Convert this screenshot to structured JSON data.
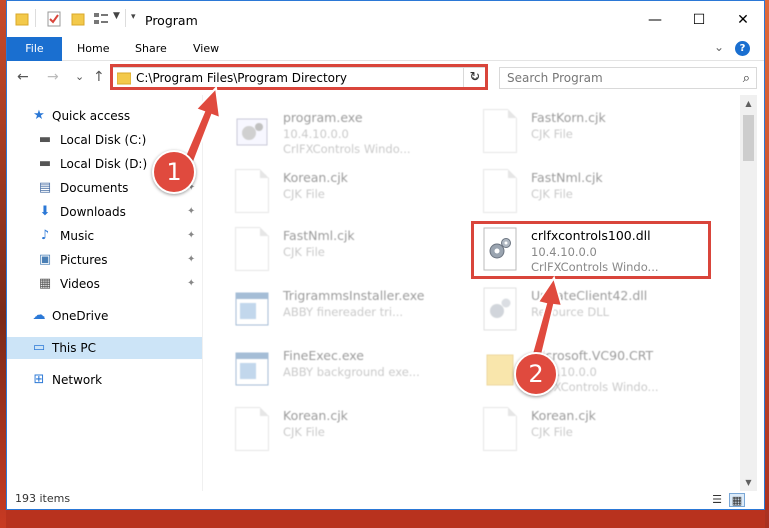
{
  "window": {
    "title": "Program",
    "minimize_glyph": "—",
    "maximize_glyph": "☐",
    "close_glyph": "✕"
  },
  "ribbon": {
    "tabs": [
      "File",
      "Home",
      "Share",
      "View"
    ],
    "help_glyph": "?",
    "collapse_glyph": "⌄"
  },
  "nav": {
    "back": "←",
    "forward": "→",
    "recent": "⌄",
    "up": "↑",
    "address": "C:\\Program Files\\Program Directory",
    "address_dropdown": "⌄",
    "refresh": "↻",
    "search_placeholder": "Search Program",
    "search_glyph": "⌕"
  },
  "sidebar": {
    "items": [
      {
        "label": "Quick access",
        "icon": "star-icon",
        "glyph": "★",
        "color": "#2b78d6"
      },
      {
        "label": "Local Disk (C:)",
        "icon": "drive-icon",
        "glyph": "▬",
        "color": "#555555"
      },
      {
        "label": "Local Disk (D:)",
        "icon": "drive-icon",
        "glyph": "▬",
        "color": "#555555"
      },
      {
        "label": "Documents",
        "icon": "documents-icon",
        "glyph": "▤",
        "color": "#4a6fa5"
      },
      {
        "label": "Downloads",
        "icon": "download-icon",
        "glyph": "⬇",
        "color": "#2b78d6"
      },
      {
        "label": "Music",
        "icon": "music-icon",
        "glyph": "♪",
        "color": "#2b78d6"
      },
      {
        "label": "Pictures",
        "icon": "pictures-icon",
        "glyph": "▣",
        "color": "#4a7fb5"
      },
      {
        "label": "Videos",
        "icon": "videos-icon",
        "glyph": "▦",
        "color": "#555555"
      },
      {
        "label": "OneDrive",
        "icon": "cloud-icon",
        "glyph": "☁",
        "color": "#2b78d6"
      },
      {
        "label": "This PC",
        "icon": "computer-icon",
        "glyph": "▭",
        "color": "#2b78d6"
      },
      {
        "label": "Network",
        "icon": "network-icon",
        "glyph": "⊞",
        "color": "#2b78d6"
      }
    ],
    "pin_glyph": "📌"
  },
  "files": [
    {
      "name": "program.exe",
      "line1": "10.4.10.0.0",
      "line2": "CrlFXControls Windo...",
      "icon": "exe-gear-icon"
    },
    {
      "name": "FastKorn.cjk",
      "line1": "CJK File",
      "line2": "",
      "icon": "document-icon"
    },
    {
      "name": "Korean.cjk",
      "line1": "CJK File",
      "line2": "",
      "icon": "document-icon"
    },
    {
      "name": "FastNml.cjk",
      "line1": "CJK File",
      "line2": "",
      "icon": "document-icon"
    },
    {
      "name": "FastNml.cjk",
      "line1": "CJK File",
      "line2": "",
      "icon": "document-icon"
    },
    {
      "name": "crlfxcontrols100.dll",
      "line1": "10.4.10.0.0",
      "line2": "CrlFXControls Windo...",
      "icon": "dll-gear-icon"
    },
    {
      "name": "TrigrammsInstaller.exe",
      "line1": "ABBY finereader tri...",
      "line2": "",
      "icon": "window-app-icon"
    },
    {
      "name": "UpdateClient42.dll",
      "line1": "Resource DLL",
      "line2": "",
      "icon": "dll-gear-icon"
    },
    {
      "name": "FineExec.exe",
      "line1": "ABBY background exe...",
      "line2": "",
      "icon": "window-app-icon"
    },
    {
      "name": "Microsoft.VC90.CRT",
      "line1": "10.4.10.0.0",
      "line2": "CrlFXControls Windo...",
      "icon": "folder-icon"
    },
    {
      "name": "Korean.cjk",
      "line1": "CJK File",
      "line2": "",
      "icon": "document-icon"
    },
    {
      "name": "Korean.cjk",
      "line1": "CJK File",
      "line2": "",
      "icon": "document-icon"
    }
  ],
  "status": {
    "count": "193 items"
  },
  "annotations": {
    "step1": "1",
    "step2": "2",
    "color": "#d9453b"
  }
}
